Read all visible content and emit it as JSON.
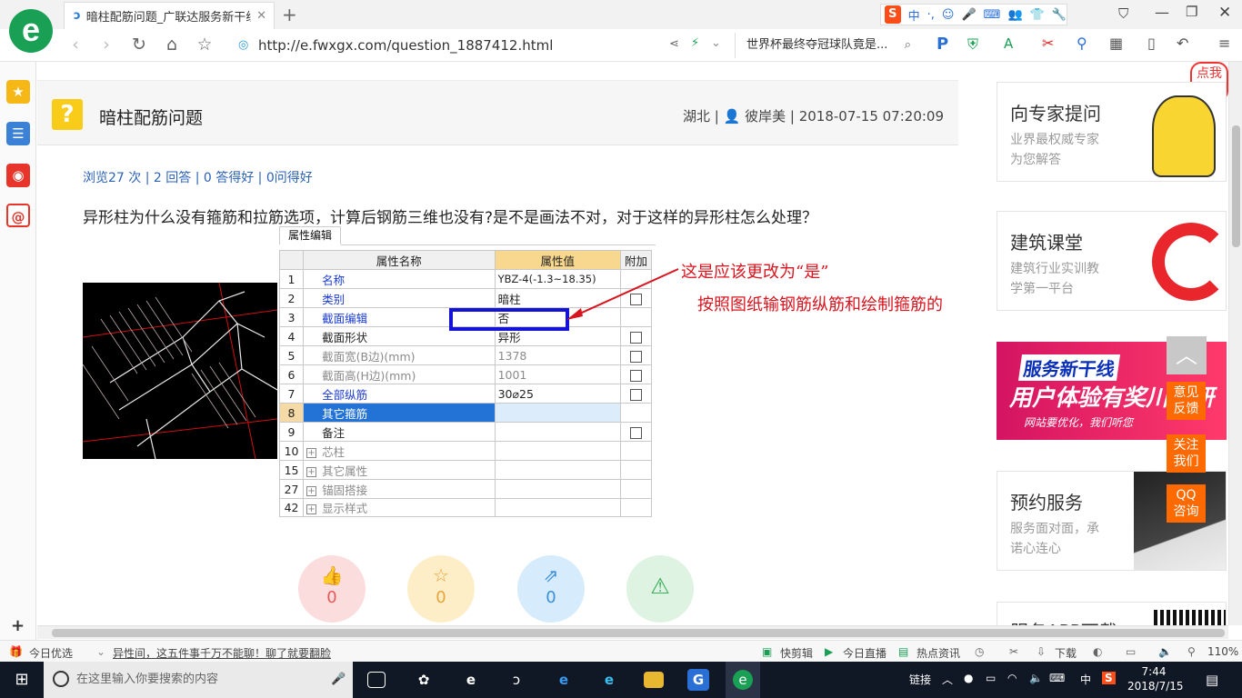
{
  "browser": {
    "tab_title": "暗柱配筋问题_广联达服务新干线",
    "url": "http://e.fwxgx.com/question_1887412.html",
    "search_text": "世界杯最终夺冠球队竟是...",
    "ime_label": "中"
  },
  "question": {
    "title": "暗柱配筋问题",
    "region": "湖北",
    "author": "彼岸美",
    "datetime": "2018-07-15 07:20:09",
    "stats": "浏览27 次 | 2 回答 | 0 答得好 | 0问得好",
    "body": "异形柱为什么没有箍筋和拉筋选项，计算后钢筋三维也没有?是不是画法不对，对于这样的异形柱怎么处理？"
  },
  "attr_panel": {
    "tab_label": "属性编辑",
    "col_name": "属性名称",
    "col_value": "属性值",
    "col_extra": "附加",
    "rows": [
      {
        "no": "1",
        "name": "名称",
        "value": "YBZ-4(-1.3~18.35)"
      },
      {
        "no": "2",
        "name": "类别",
        "value": "暗柱"
      },
      {
        "no": "3",
        "name": "截面编辑",
        "value": "否"
      },
      {
        "no": "4",
        "name": "截面形状",
        "value": "异形"
      },
      {
        "no": "5",
        "name": "截面宽(B边)(mm)",
        "value": "1378"
      },
      {
        "no": "6",
        "name": "截面高(H边)(mm)",
        "value": "1001"
      },
      {
        "no": "7",
        "name": "全部纵筋",
        "value": "30⌀25"
      },
      {
        "no": "8",
        "name": "其它箍筋",
        "value": ""
      },
      {
        "no": "9",
        "name": "备注",
        "value": ""
      },
      {
        "no": "10",
        "name": "芯柱",
        "value": ""
      },
      {
        "no": "15",
        "name": "其它属性",
        "value": ""
      },
      {
        "no": "27",
        "name": "锚固搭接",
        "value": ""
      },
      {
        "no": "42",
        "name": "显示样式",
        "value": ""
      }
    ]
  },
  "annotations": {
    "line1": "这是应该更改为“是”",
    "line2": "按照图纸输钢筋纵筋和绘制箍筋的"
  },
  "actions": {
    "like_count": "0",
    "fav_count": "0",
    "share_count": "0"
  },
  "right_column": {
    "expert_title": "向专家提问",
    "expert_sub1": "业界最权威专家",
    "expert_sub2": "为您解答",
    "course_title": "建筑课堂",
    "course_sub1": "建筑行业实训教",
    "course_sub2": "学第一平台",
    "banner_tag": "服务新干线",
    "banner_main": "用户体验有奖川调研",
    "banner_sub": "网站要优化，我们听您",
    "booking_title": "预约服务",
    "booking_sub1": "服务面对面，承",
    "booking_sub2": "诺心连心",
    "app_title": "服务APP下载",
    "bubble_text": "点我提问",
    "float_feedback": "意见反馈",
    "float_follow": "关注我们",
    "float_qq": "QQ咨询"
  },
  "statusbar": {
    "daily_pick": "今日优选",
    "news": "异性间，这五件事千万不能聊！聊了就要翻脸",
    "quick_cut": "快剪辑",
    "live": "今日直播",
    "hot_news": "热点资讯",
    "download": "下载",
    "zoom": "110%"
  },
  "taskbar": {
    "search_placeholder": "在这里输入你要搜索的内容",
    "tray_link": "链接",
    "tray_ime": "中",
    "time": "7:44",
    "date": "2018/7/15"
  },
  "colors": {
    "accent_green": "#1aa055",
    "link_blue": "#2c62b7",
    "annotation_red": "#d8141e",
    "float_orange": "#ff6a00"
  }
}
